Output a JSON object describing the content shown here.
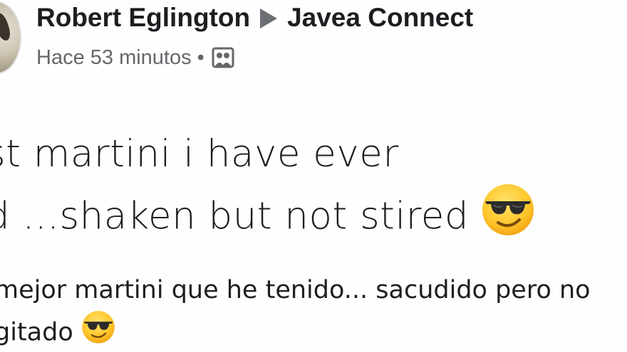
{
  "post": {
    "author": "Robert Eglington",
    "group": "Javea Connect",
    "time": "Hace 53 minutos",
    "separator": "•",
    "audience_icon": "group-icon",
    "text_en_line1": "st martini i have ever",
    "text_en_line2": "d ...shaken but not stired",
    "text_es_line1": "mejor martini que he tenido... sacudido pero no",
    "text_es_line2": "gitado",
    "emoji": "smiling-face-with-sunglasses"
  }
}
